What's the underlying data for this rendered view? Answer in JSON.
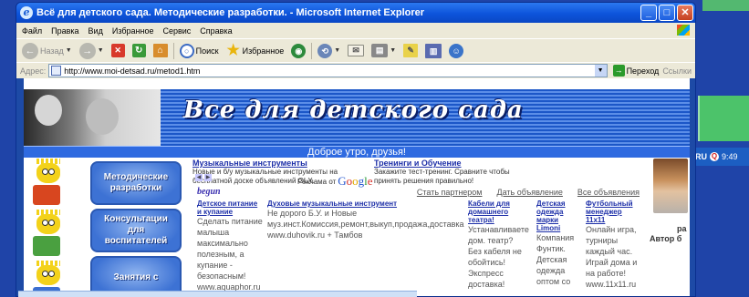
{
  "window": {
    "title": "Всё для детского сада. Методические разработки. - Microsoft Internet Explorer",
    "buttons": {
      "minimize": "_",
      "maximize": "□",
      "close": "✕"
    }
  },
  "menu": [
    "Файл",
    "Правка",
    "Вид",
    "Избранное",
    "Сервис",
    "Справка"
  ],
  "toolbar": {
    "back_label": "Назад",
    "search_label": "Поиск",
    "favorites_label": "Избранное"
  },
  "address": {
    "label": "Адрес:",
    "url": "http://www.moi-detsad.ru/metod1.htm",
    "go_label": "Переход",
    "links_label": "Ссылки"
  },
  "taskbar": {
    "lang": "RU",
    "clock": "9:49"
  },
  "page": {
    "banner_title": "Все для детского сада",
    "greeting": "Доброе утро, друзья!",
    "sidebar_buttons": [
      "Методические разработки",
      "Консультации для воспитателей",
      "Занятия с"
    ],
    "top_ads": [
      {
        "title": "Музыкальные инструменты",
        "text": "Новые и б/у музыкальные инструменты на бесплатной доске объявлений OLX."
      },
      {
        "title": "Тренинги и Обучение",
        "text": "Закажите тест-тренинг. Сравните чтобы принять решения правильно!"
      }
    ],
    "google_ads_label": "Реклама от",
    "google_word": "Google",
    "begun": "begun",
    "nav_links": [
      "Стать партнером",
      "Дать объявление",
      "Все объявления"
    ],
    "ad_columns": [
      {
        "title": "Детское питание и купание",
        "text": "Сделать питание малыша максимально полезным, а купание - безопасным! www.aquaphor.ru"
      },
      {
        "title": "Духовые музыкальные инструмент",
        "text": "Не дорого Б.У. и Новые муз.инст.Комиссия,ремонт,выкуп,продажа,доставка www.duhovik.ru + Тамбов"
      },
      {
        "title": "Кабели для домашнего театра!",
        "text": "Устанавливаете дом. театр? Без кабеля не обойтись! Экспресс доставка!"
      },
      {
        "title": "Детская одежда марки Limoni",
        "text": "Компания Фунтик. Детская одежда оптом со"
      },
      {
        "title": "Футбольный менеджер 11x11",
        "text": "Онлайн игра, турниры каждый час. Играй дома и на работе! www.11x11.ru"
      }
    ],
    "right_partial_1": "ра",
    "right_partial_2": "Автор б"
  }
}
